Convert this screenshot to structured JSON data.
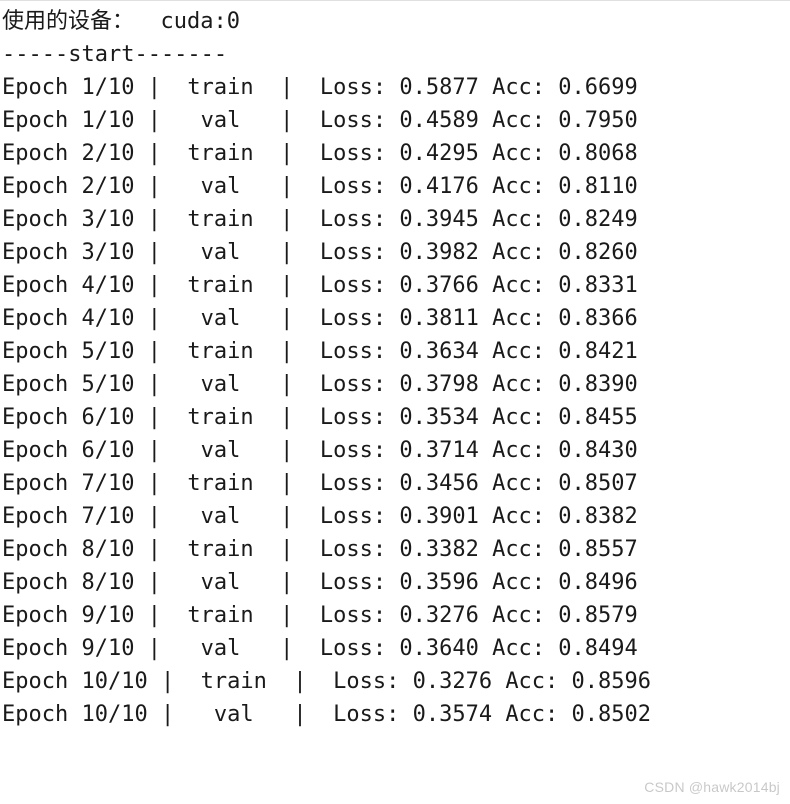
{
  "header": {
    "device_label": "使用的设备：",
    "device_value": "cuda:0",
    "start_line": "-----start-------"
  },
  "epochs": [
    {
      "epoch": 1,
      "total": 10,
      "phase": "train",
      "loss": "0.5877",
      "acc": "0.6699"
    },
    {
      "epoch": 1,
      "total": 10,
      "phase": "val",
      "loss": "0.4589",
      "acc": "0.7950"
    },
    {
      "epoch": 2,
      "total": 10,
      "phase": "train",
      "loss": "0.4295",
      "acc": "0.8068"
    },
    {
      "epoch": 2,
      "total": 10,
      "phase": "val",
      "loss": "0.4176",
      "acc": "0.8110"
    },
    {
      "epoch": 3,
      "total": 10,
      "phase": "train",
      "loss": "0.3945",
      "acc": "0.8249"
    },
    {
      "epoch": 3,
      "total": 10,
      "phase": "val",
      "loss": "0.3982",
      "acc": "0.8260"
    },
    {
      "epoch": 4,
      "total": 10,
      "phase": "train",
      "loss": "0.3766",
      "acc": "0.8331"
    },
    {
      "epoch": 4,
      "total": 10,
      "phase": "val",
      "loss": "0.3811",
      "acc": "0.8366"
    },
    {
      "epoch": 5,
      "total": 10,
      "phase": "train",
      "loss": "0.3634",
      "acc": "0.8421"
    },
    {
      "epoch": 5,
      "total": 10,
      "phase": "val",
      "loss": "0.3798",
      "acc": "0.8390"
    },
    {
      "epoch": 6,
      "total": 10,
      "phase": "train",
      "loss": "0.3534",
      "acc": "0.8455"
    },
    {
      "epoch": 6,
      "total": 10,
      "phase": "val",
      "loss": "0.3714",
      "acc": "0.8430"
    },
    {
      "epoch": 7,
      "total": 10,
      "phase": "train",
      "loss": "0.3456",
      "acc": "0.8507"
    },
    {
      "epoch": 7,
      "total": 10,
      "phase": "val",
      "loss": "0.3901",
      "acc": "0.8382"
    },
    {
      "epoch": 8,
      "total": 10,
      "phase": "train",
      "loss": "0.3382",
      "acc": "0.8557"
    },
    {
      "epoch": 8,
      "total": 10,
      "phase": "val",
      "loss": "0.3596",
      "acc": "0.8496"
    },
    {
      "epoch": 9,
      "total": 10,
      "phase": "train",
      "loss": "0.3276",
      "acc": "0.8579"
    },
    {
      "epoch": 9,
      "total": 10,
      "phase": "val",
      "loss": "0.3640",
      "acc": "0.8494"
    },
    {
      "epoch": 10,
      "total": 10,
      "phase": "train",
      "loss": "0.3276",
      "acc": "0.8596"
    },
    {
      "epoch": 10,
      "total": 10,
      "phase": "val",
      "loss": "0.3574",
      "acc": "0.8502"
    }
  ],
  "labels": {
    "epoch_prefix": "Epoch",
    "loss_label": "Loss:",
    "acc_label": "Acc:"
  },
  "watermark": "CSDN @hawk2014bj"
}
